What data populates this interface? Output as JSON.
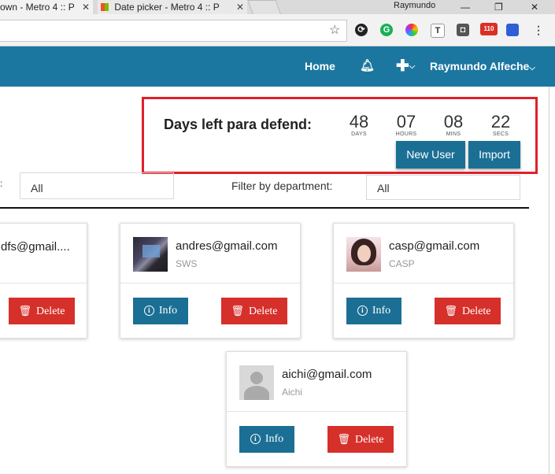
{
  "browser": {
    "tabs": [
      {
        "title": "own - Metro 4 :: P"
      },
      {
        "title": "Date picker - Metro 4 :: P"
      }
    ],
    "profile_name": "Raymundo",
    "mail_badge": "110"
  },
  "navbar": {
    "home": "Home",
    "user": "Raymundo Alfeche"
  },
  "countdown": {
    "title": "Days left para defend:",
    "units": [
      {
        "value": "48",
        "label": "DAYS"
      },
      {
        "value": "07",
        "label": "HOURS"
      },
      {
        "value": "08",
        "label": "MINS"
      },
      {
        "value": "22",
        "label": "SECS"
      }
    ]
  },
  "actions": {
    "new_user": "New User",
    "import": "Import"
  },
  "filters": {
    "left_value": "All",
    "department_label": "Filter by department:",
    "department_value": "All"
  },
  "cards": [
    {
      "email": "dfs@gmail....",
      "dept": "",
      "delete": "Delete"
    },
    {
      "email": "andres@gmail.com",
      "dept": "SWS",
      "info": "Info",
      "delete": "Delete"
    },
    {
      "email": "casp@gmail.com",
      "dept": "CASP",
      "info": "Info",
      "delete": "Delete"
    },
    {
      "email": "aichi@gmail.com",
      "dept": "Aichi",
      "info": "Info",
      "delete": "Delete"
    }
  ],
  "colors": {
    "primary": "#1b77a0",
    "button_blue": "#1b6f94",
    "delete_red": "#d6302b",
    "highlight_border": "#e0202a"
  }
}
